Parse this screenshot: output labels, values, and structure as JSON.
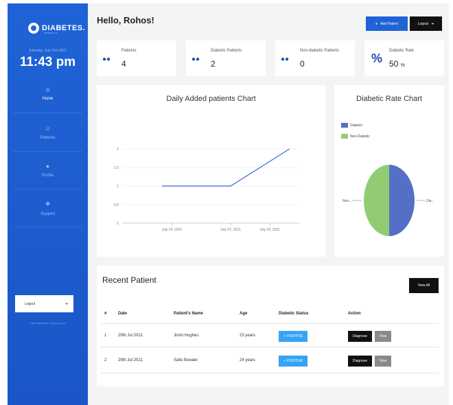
{
  "sidebar": {
    "brand": "DIABETES.",
    "brand_sub": "PREDICT",
    "date": "Saturday, July 31st 2021",
    "time": "11:43 pm",
    "nav": [
      {
        "label": "Home",
        "icon": "home-icon",
        "active": true
      },
      {
        "label": "Patients",
        "icon": "users-icon",
        "active": false
      },
      {
        "label": "Profile",
        "icon": "user-icon",
        "active": false
      },
      {
        "label": "Support",
        "icon": "support-icon",
        "active": false
      }
    ],
    "logout_label": "Logout",
    "copyright": "© 2021 Diab Predict. All rights reserved"
  },
  "header": {
    "greeting": "Hello, Rohos!",
    "add_patient": "Add Patient",
    "logout": "Logout"
  },
  "stats": [
    {
      "label": "Patients",
      "value": "4",
      "icon": "users-icon"
    },
    {
      "label": "Diabetic Patients",
      "value": "2",
      "icon": "users-icon"
    },
    {
      "label": "Non-diabetic Patients",
      "value": "0",
      "icon": "users-icon"
    },
    {
      "label": "Diabetic Rate",
      "value": "50",
      "unit": "%",
      "icon": "percent-icon"
    }
  ],
  "daily_chart": {
    "title": "Daily Added patients Chart"
  },
  "rate_chart": {
    "title": "Diabetic Rate Chart",
    "legend": [
      {
        "label": "Diabetic",
        "color": "#5470c6"
      },
      {
        "label": "Non-Diabetic",
        "color": "#91cc75"
      }
    ],
    "label_left": "Non...",
    "label_right": "Dia..."
  },
  "chart_data": [
    {
      "type": "line",
      "title": "Daily Added patients Chart",
      "x": [
        "July 24, 2021",
        "July 27, 2021",
        "July 29, 2021"
      ],
      "x_days": [
        24,
        27,
        29
      ],
      "points": [
        {
          "x": 23.5,
          "y": 1
        },
        {
          "x": 27,
          "y": 1
        },
        {
          "x": 30,
          "y": 2
        }
      ],
      "yticks": [
        "0",
        "0.5",
        "1",
        "1.5",
        "2"
      ],
      "ylim": [
        0,
        2
      ],
      "xlim": [
        21.5,
        30.5
      ],
      "color": "#3a63c9",
      "grid": true
    },
    {
      "type": "pie",
      "title": "Diabetic Rate Chart",
      "labels": [
        "Diabetic",
        "Non-Diabetic"
      ],
      "values": [
        50,
        50
      ],
      "colors": [
        "#5470c6",
        "#91cc75"
      ]
    }
  ],
  "recent": {
    "title": "Recent Patient",
    "view_all": "View All",
    "columns": [
      "#",
      "Date",
      "Patient's Name",
      "Age",
      "Diabetic Status",
      "Action"
    ],
    "rows": [
      {
        "num": "1",
        "date": "29th Jul 2021",
        "name": "Jinmi Hughes",
        "age": "23 years",
        "status": "POSITIVE"
      },
      {
        "num": "2",
        "date": "29th Jul 2021",
        "name": "Sallu Bowale",
        "age": "24 years",
        "status": "POSITIVE"
      }
    ],
    "diagnose_label": "Diagnose",
    "view_label": "View"
  }
}
